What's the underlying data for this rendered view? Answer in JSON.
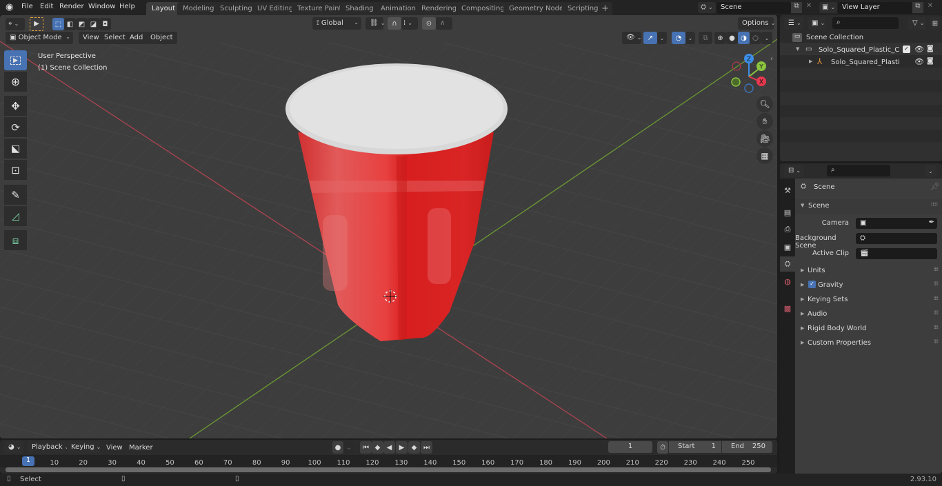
{
  "topbar": {
    "menus": [
      "File",
      "Edit",
      "Render",
      "Window",
      "Help"
    ],
    "workspaces": [
      "Layout",
      "Modeling",
      "Sculpting",
      "UV Editing",
      "Texture Paint",
      "Shading",
      "Animation",
      "Rendering",
      "Compositing",
      "Geometry Nodes",
      "Scripting"
    ],
    "active_workspace": "Layout",
    "add_workspace": "+",
    "scene_name": "Scene",
    "view_layer_name": "View Layer"
  },
  "viewport": {
    "header": {
      "mode": "Object Mode",
      "menus": [
        "View",
        "Select",
        "Add",
        "Object"
      ],
      "transform_orientation": "Global",
      "options_label": "Options"
    },
    "overlay_text": {
      "perspective": "User Perspective",
      "collection": "(1) Scene Collection"
    },
    "tools": [
      "select-box",
      "cursor",
      "move",
      "rotate",
      "scale",
      "transform",
      "annotate",
      "measure",
      "add-cube"
    ],
    "gizmo_axes": {
      "x": "X",
      "y": "Y",
      "z": "Z"
    },
    "axis_colors": {
      "x": "#e8384f",
      "y": "#8bc53f",
      "z": "#3d8ee8"
    },
    "object": {
      "name": "Solo_Squared_Plastic_Cup",
      "body_color": "#d81e1e",
      "rim_color": "#dcdcdc"
    }
  },
  "outliner": {
    "search_placeholder": "",
    "root": "Scene Collection",
    "items": [
      {
        "name": "Solo_Squared_Plastic_Cup_wi",
        "type": "collection",
        "checked": true
      },
      {
        "name": "Solo_Squared_Plastic_Cu",
        "type": "empty"
      }
    ]
  },
  "properties": {
    "search_placeholder": "",
    "context": "Scene",
    "section": "Scene",
    "fields": [
      {
        "label": "Camera",
        "value": ""
      },
      {
        "label": "Background Scene",
        "value": ""
      },
      {
        "label": "Active Clip",
        "value": ""
      }
    ],
    "panels": [
      "Units",
      "Gravity",
      "Keying Sets",
      "Audio",
      "Rigid Body World",
      "Custom Properties"
    ],
    "gravity_enabled": true
  },
  "timeline": {
    "menus": [
      "Playback",
      "Keying",
      "View",
      "Marker"
    ],
    "current_frame": "1",
    "start_label": "Start",
    "start": "1",
    "end_label": "End",
    "end": "250",
    "ticks": [
      "10",
      "20",
      "30",
      "40",
      "50",
      "60",
      "70",
      "80",
      "90",
      "100",
      "110",
      "120",
      "130",
      "140",
      "150",
      "160",
      "170",
      "180",
      "190",
      "200",
      "210",
      "220",
      "230",
      "240",
      "250"
    ],
    "playhead": "1"
  },
  "statusbar": {
    "left_action": "Select",
    "version": "2.93.10"
  }
}
